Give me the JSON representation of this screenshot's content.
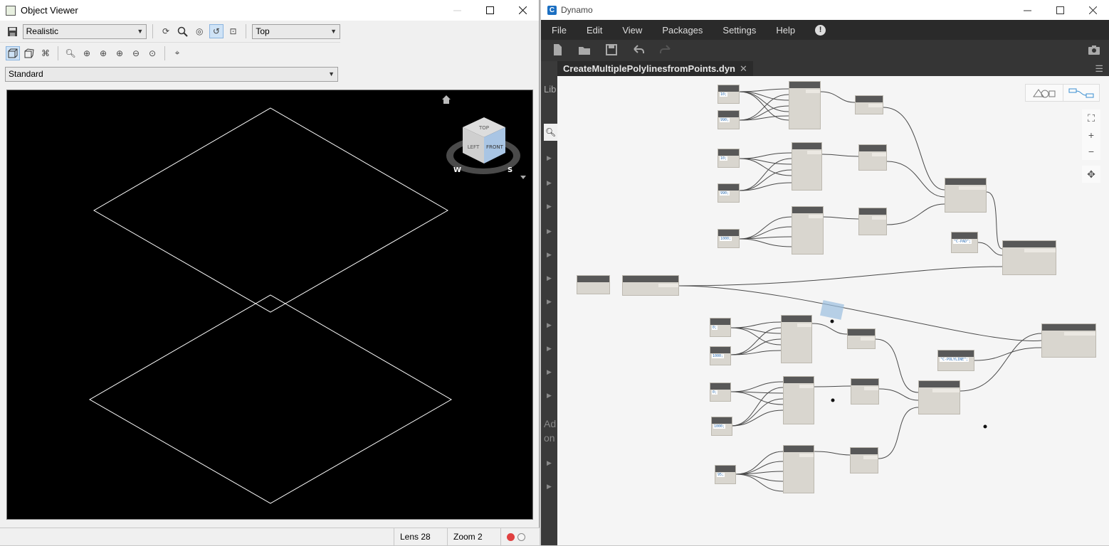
{
  "object_viewer": {
    "title": "Object Viewer",
    "visual_style": "Realistic",
    "view_direction": "Top",
    "named_view": "Standard",
    "status": {
      "lens": "Lens 28",
      "zoom": "Zoom 2"
    },
    "navcube": {
      "face_top": "TOP",
      "face_left": "LEFT",
      "face_front": "FRONT",
      "compass_w": "W",
      "compass_s": "S"
    }
  },
  "dynamo": {
    "title": "Dynamo",
    "menu": [
      "File",
      "Edit",
      "View",
      "Packages",
      "Settings",
      "Help"
    ],
    "library_label": "Lib",
    "library_add_text": "Ad\non",
    "tab": {
      "label": "CreateMultiplePolylinesfromPoints.dyn"
    },
    "code_blocks": {
      "n1": "10;",
      "n2": "990;",
      "n3": "10;",
      "n4": "990;",
      "n5": "1000;",
      "n6": "0;",
      "n7": "1000;",
      "n8": "0;",
      "n9": "1000;",
      "n10": "95;",
      "layer1": "\"C-PAD\";",
      "layer2": "\"C-POLYLINE\";"
    }
  }
}
